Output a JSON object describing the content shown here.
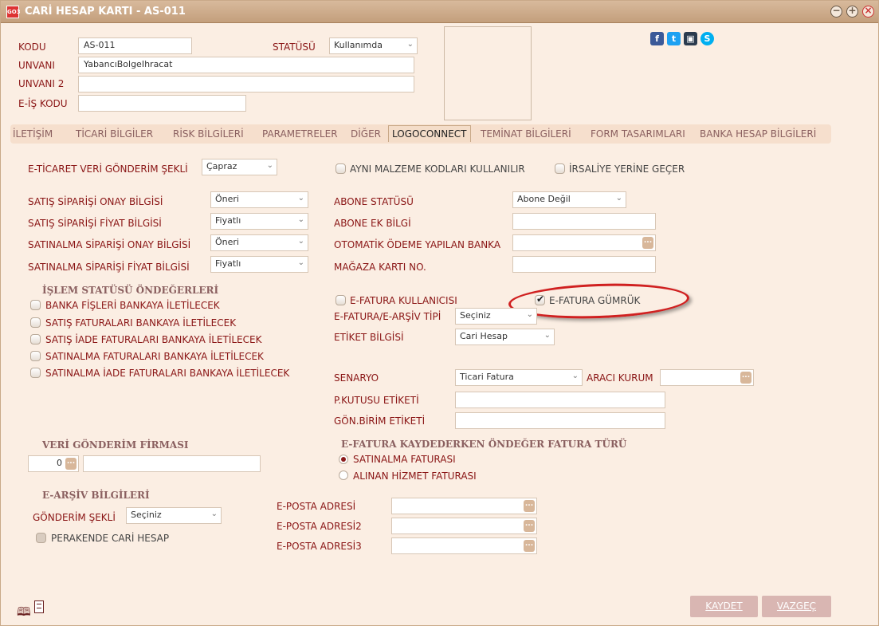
{
  "window": {
    "title": "CARİ HESAP KARTI - AS-011",
    "app_icon_text": "GO3"
  },
  "header": {
    "kodu_label": "KODU",
    "kodu_value": "AS-011",
    "statusu_label": "STATÜSÜ",
    "statusu_value": "Kullanımda",
    "unvani_label": "UNVANI",
    "unvani_value": "YabancıBolgeIhracat",
    "unvani2_label": "UNVANI 2",
    "unvani2_value": "",
    "eis_kodu_label": "E-İŞ KODU",
    "eis_kodu_value": ""
  },
  "social": [
    "facebook-icon",
    "twitter-icon",
    "box-icon",
    "skype-icon"
  ],
  "tabs": [
    {
      "label": "İLETİŞİM",
      "active": false
    },
    {
      "label": "TİCARİ BİLGİLER",
      "active": false
    },
    {
      "label": "RİSK BİLGİLERİ",
      "active": false
    },
    {
      "label": "PARAMETRELER",
      "active": false
    },
    {
      "label": "DİĞER",
      "active": false
    },
    {
      "label": "LOGOCONNECT",
      "active": true
    },
    {
      "label": "TEMİNAT BİLGİLERİ",
      "active": false
    },
    {
      "label": "FORM TASARIMLARI",
      "active": false
    },
    {
      "label": "BANKA HESAP BİLGİLERİ",
      "active": false
    }
  ],
  "eticaret": {
    "label": "E-TİCARET VERİ GÖNDERİM ŞEKLİ",
    "value": "Çapraz"
  },
  "aynı_malzeme": {
    "label": "AYNI MALZEME KODLARI KULLANILIR",
    "checked": false
  },
  "irsaliye": {
    "label": "İRSALİYE YERİNE GEÇER",
    "checked": false
  },
  "left_fields": [
    {
      "label": "SATIŞ SİPARİŞİ ONAY BİLGİSİ",
      "value": "Öneri"
    },
    {
      "label": "SATIŞ SİPARİŞİ FİYAT BİLGİSİ",
      "value": "Fiyatlı"
    },
    {
      "label": "SATINALMA SİPARİŞİ ONAY BİLGİSİ",
      "value": "Öneri"
    },
    {
      "label": "SATINALMA SİPARİŞİ FİYAT BİLGİSİ",
      "value": "Fiyatlı"
    }
  ],
  "right_fields": {
    "abone_statusu_label": "ABONE STATÜSÜ",
    "abone_statusu_value": "Abone Değil",
    "abone_ek_label": "ABONE EK BİLGİ",
    "abone_ek_value": "",
    "otomatik_label": "OTOMATİK ÖDEME YAPILAN BANKA",
    "otomatik_value": "",
    "magaza_label": "MAĞAZA KARTI NO.",
    "magaza_value": ""
  },
  "islem_statusu": {
    "title": "İŞLEM STATÜSÜ ÖNDEĞERLERİ",
    "items": [
      {
        "label": "BANKA FİŞLERİ BANKAYA İLETİLECEK",
        "checked": false
      },
      {
        "label": "SATIŞ FATURALARI BANKAYA İLETİLECEK",
        "checked": false
      },
      {
        "label": "SATIŞ İADE FATURALARI BANKAYA İLETİLECEK",
        "checked": false
      },
      {
        "label": "SATINALMA FATURALARI BANKAYA İLETİLECEK",
        "checked": false
      },
      {
        "label": "SATINALMA İADE FATURALARI BANKAYA İLETİLECEK",
        "checked": false
      }
    ]
  },
  "efatura": {
    "kullanici_label": "E-FATURA KULLANICISI",
    "kullanici_checked": false,
    "gumruk_label": "E-FATURA GÜMRÜK",
    "gumruk_checked": true,
    "tipi_label": "E-FATURA/E-ARŞİV TİPİ",
    "tipi_value": "Seçiniz",
    "etiket_label": "ETİKET BİLGİSİ",
    "etiket_value": "Cari Hesap",
    "senaryo_label": "SENARYO",
    "senaryo_value": "Ticari Fatura",
    "araci_label": "ARACI KURUM",
    "araci_value": "",
    "pkutusu_label": "P.KUTUSU ETİKETİ",
    "pkutusu_value": "",
    "gonbirim_label": "GÖN.BİRİM ETİKETİ",
    "gonbirim_value": ""
  },
  "veri_gonderim": {
    "title": "VERİ GÖNDERİM FİRMASI",
    "code": "0",
    "name": ""
  },
  "kaydederken": {
    "title": "E-FATURA KAYDEDERKEN ÖNDEĞER FATURA TÜRÜ",
    "option1": "SATINALMA FATURASI",
    "option2": "ALINAN HİZMET FATURASI",
    "selected": 1
  },
  "earsiv": {
    "title": "E-ARŞİV BİLGİLERİ",
    "gonderim_label": "GÖNDERİM ŞEKLİ",
    "gonderim_value": "Seçiniz",
    "perakende_label": "PERAKENDE CARİ HESAP",
    "perakende_checked": false
  },
  "eposta": {
    "label1": "E-POSTA ADRESİ",
    "label2": "E-POSTA ADRESİ2",
    "label3": "E-POSTA ADRESİ3",
    "value1": "",
    "value2": "",
    "value3": ""
  },
  "buttons": {
    "kaydet": "KAYDET",
    "vazgec": "VAZGEÇ"
  },
  "dots_label": "...",
  "colors": {
    "accent": "#8a1515",
    "background": "#fbeee3",
    "titlebar": "#c9a989",
    "highlight": "#d02020"
  }
}
